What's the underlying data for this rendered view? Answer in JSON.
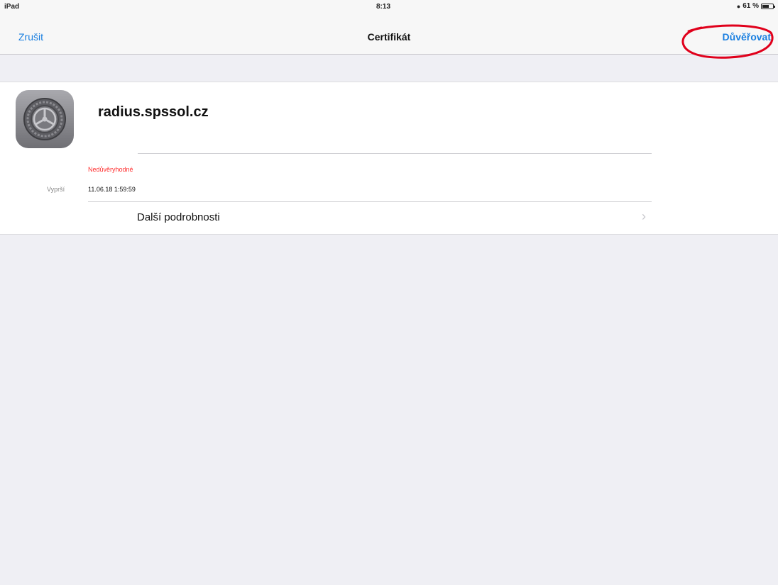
{
  "status_bar": {
    "device": "iPad",
    "time": "8:13",
    "battery_text": "61 %",
    "battery_level": 0.61
  },
  "nav": {
    "cancel_label": "Zrušit",
    "title": "Certifikát",
    "trust_label": "Důvěřovat"
  },
  "certificate": {
    "name": "radius.spssol.cz",
    "status": "Nedůvěryhodné",
    "expires_label": "Vyprší",
    "expires_value": "11.06.18 1:59:59",
    "details_label": "Další podrobnosti"
  },
  "colors": {
    "accent": "#1a7fe0",
    "warning": "#ff2d2d",
    "highlight": "#e0001b"
  },
  "icons": {
    "app": "settings-gear-icon",
    "details": "chevron-right-icon",
    "lock": "orientation-lock-icon",
    "battery": "battery-icon"
  }
}
